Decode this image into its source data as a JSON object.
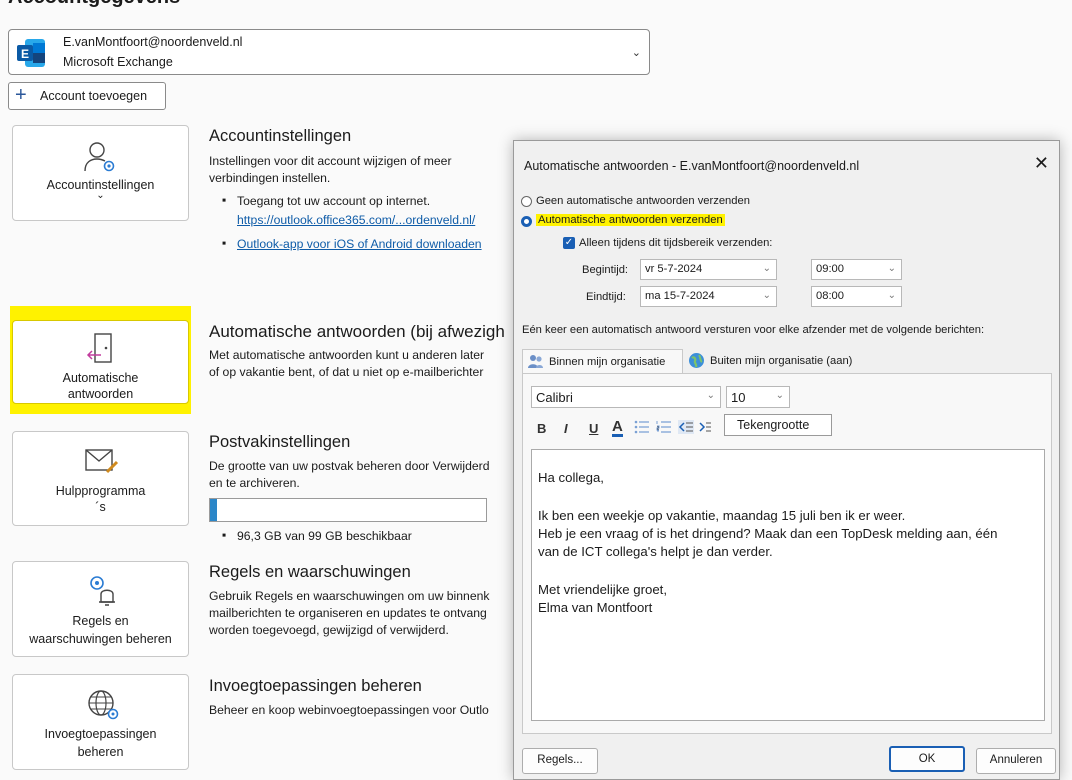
{
  "page": {
    "title": "Accountgegevens"
  },
  "account": {
    "email": "E.vanMontfoort@noordenveld.nl",
    "type": "Microsoft Exchange"
  },
  "add_account_label": "Account toevoegen",
  "tiles": {
    "account_settings": {
      "label": "Accountinstellingen"
    },
    "auto_replies": {
      "label_line1": "Automatische",
      "label_line2": "antwoorden"
    },
    "tools": {
      "label_line1": "Hulpprogramma",
      "label_line2": "´s"
    },
    "rules": {
      "label_line1": "Regels en",
      "label_line2": "waarschuwingen beheren"
    },
    "addins": {
      "label_line1": "Invoegtoepassingen",
      "label_line2": "beheren"
    }
  },
  "sections": {
    "account_settings": {
      "title": "Accountinstellingen",
      "desc_line1": "Instellingen voor dit account wijzigen of meer",
      "desc_line2": "verbindingen instellen.",
      "bullet1": "Toegang tot uw account op internet.",
      "link1": "https://outlook.office365.com/...ordenveld.nl/",
      "link2": "Outlook-app voor iOS of Android downloaden"
    },
    "auto_replies": {
      "title": "Automatische antwoorden (bij afwezigh",
      "desc_line1": "Met automatische antwoorden kunt u anderen later",
      "desc_line2": "of op vakantie bent, of dat u niet op e-mailberichter"
    },
    "mailbox": {
      "title": "Postvakinstellingen",
      "desc_line1": "De grootte van uw postvak beheren door Verwijderd",
      "desc_line2": "en te archiveren.",
      "usage_text": "96,3 GB van 99 GB beschikbaar",
      "usage_fraction": 0.027
    },
    "rules": {
      "title": "Regels en waarschuwingen",
      "desc_line1": "Gebruik Regels en waarschuwingen om uw binnenk",
      "desc_line2": "mailberichten te organiseren en updates te ontvang",
      "desc_line3": "worden toegevoegd, gewijzigd of verwijderd."
    },
    "addins": {
      "title": "Invoegtoepassingen beheren",
      "desc_line1": "Beheer en koop webinvoegtoepassingen voor Outlo"
    }
  },
  "dialog": {
    "title": "Automatische antwoorden - E.vanMontfoort@noordenveld.nl",
    "close_glyph": "✕",
    "radio_off_label": "Geen automatische antwoorden verzenden",
    "radio_on_label": "Automatische antwoorden verzenden",
    "checkbox_label": "Alleen tijdens dit tijdsbereik verzenden:",
    "start_label": "Begintijd:",
    "start_date": "vr 5-7-2024",
    "start_time": "09:00",
    "end_label": "Eindtijd:",
    "end_date": "ma 15-7-2024",
    "end_time": "08:00",
    "once_text": "Eén keer een automatisch antwoord versturen voor elke afzender met de volgende berichten:",
    "tab_inside": "Binnen mijn organisatie",
    "tab_outside": "Buiten mijn organisatie (aan)",
    "font_name": "Calibri",
    "font_size": "10",
    "tooltip": "Tekengrootte",
    "format": {
      "bold": "B",
      "italic": "I",
      "underline": "U",
      "color": "A"
    },
    "message_lines": [
      "Ha collega,",
      "",
      "Ik ben een weekje op vakantie, maandag 15 juli ben ik er weer.",
      "Heb je een vraag of is het dringend? Maak dan een TopDesk melding aan,  één",
      "van de ICT collega's helpt je dan verder.",
      "",
      "Met vriendelijke groet,",
      "Elma van Montfoort"
    ],
    "rules_button": "Regels...",
    "ok_button": "OK",
    "cancel_button": "Annuleren"
  },
  "colors": {
    "highlight": "#fff200",
    "accent": "#1a5fb4",
    "link": "#0f5ca8"
  },
  "icons": [
    "exchange-logo-icon",
    "plus-icon",
    "person-gear-icon",
    "door-arrow-icon",
    "envelope-brush-icon",
    "gear-bell-icon",
    "globe-gear-icon",
    "people-icon",
    "globe-icon",
    "chevron-down-icon",
    "close-icon"
  ]
}
